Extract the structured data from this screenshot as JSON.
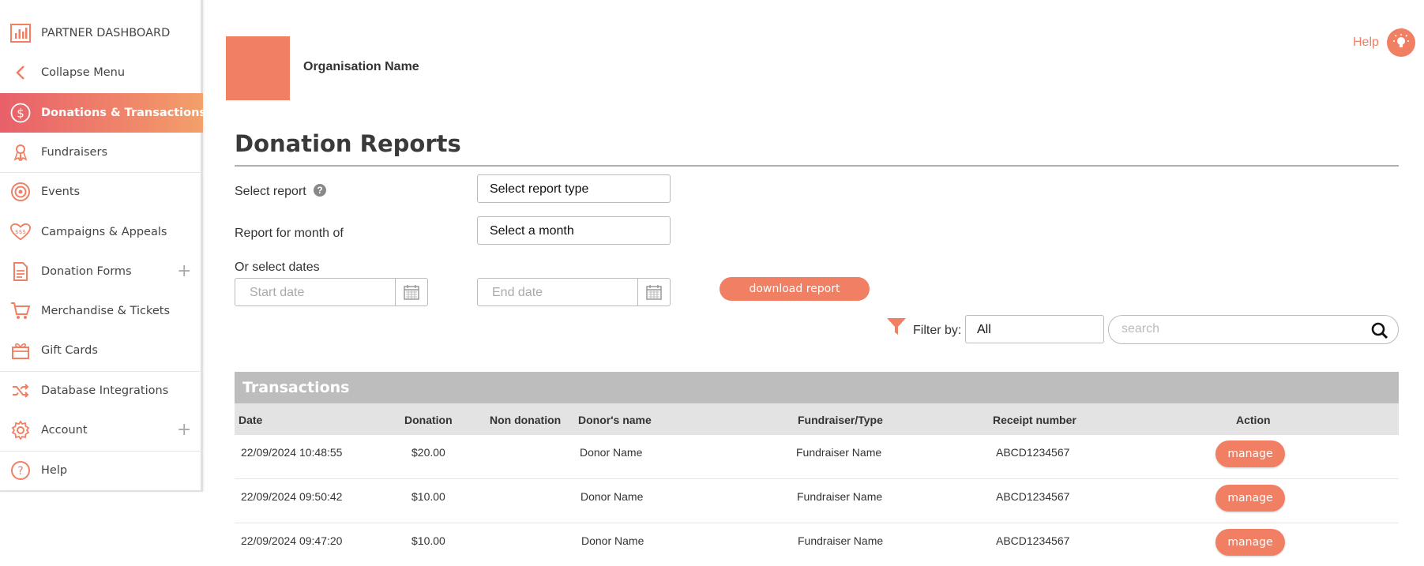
{
  "sidebar": {
    "items": [
      {
        "label": "PARTNER DASHBOARD",
        "icon": "bar-chart-icon"
      },
      {
        "label": "Collapse Menu",
        "icon": "chevron-left-icon"
      },
      {
        "label": "Donations & Transactions",
        "icon": "dollar-circle-icon",
        "active": true
      },
      {
        "label": "Fundraisers",
        "icon": "ribbon-icon"
      },
      {
        "label": "Events",
        "icon": "target-icon"
      },
      {
        "label": "Campaigns & Appeals",
        "icon": "heart-money-icon"
      },
      {
        "label": "Donation Forms",
        "icon": "document-icon",
        "plus": "+"
      },
      {
        "label": "Merchandise & Tickets",
        "icon": "cart-icon"
      },
      {
        "label": "Gift Cards",
        "icon": "gift-icon"
      },
      {
        "label": "Database Integrations",
        "icon": "shuffle-icon"
      },
      {
        "label": "Account",
        "icon": "gear-icon",
        "plus": "+"
      },
      {
        "label": "Help",
        "icon": "question-circle-icon"
      }
    ]
  },
  "header": {
    "org_name": "Organisation Name",
    "help_label": "Help"
  },
  "page": {
    "title": "Donation Reports"
  },
  "form": {
    "select_report_label": "Select report",
    "report_type_value": "Select report type",
    "month_label": "Report for month of",
    "month_value": "Select a month",
    "dates_label": "Or select dates",
    "start_placeholder": "Start date",
    "end_placeholder": "End date",
    "download_label": "download report"
  },
  "filter": {
    "label": "Filter by:",
    "value": "All",
    "search_placeholder": "search"
  },
  "table": {
    "title": "Transactions",
    "columns": [
      "Date",
      "Donation",
      "Non donation",
      "Donor's name",
      "Fundraiser/Type",
      "Receipt number",
      "Action"
    ],
    "rows": [
      {
        "date": "22/09/2024 10:48:55",
        "donation": "$20.00",
        "non_donation": "",
        "donor": "Donor Name",
        "fundraiser": "Fundraiser Name",
        "receipt": "ABCD1234567",
        "action": "manage"
      },
      {
        "date": "22/09/2024 09:50:42",
        "donation": "$10.00",
        "non_donation": "",
        "donor": "Donor Name",
        "fundraiser": "Fundraiser Name",
        "receipt": "ABCD1234567",
        "action": "manage"
      },
      {
        "date": "22/09/2024 09:47:20",
        "donation": "$10.00",
        "non_donation": "",
        "donor": "Donor Name",
        "fundraiser": "Fundraiser Name",
        "receipt": "ABCD1234567",
        "action": "manage"
      }
    ]
  },
  "colors": {
    "accent": "#f07f63",
    "active_gradient_start": "#e8606a",
    "active_gradient_end": "#f3a06a"
  }
}
